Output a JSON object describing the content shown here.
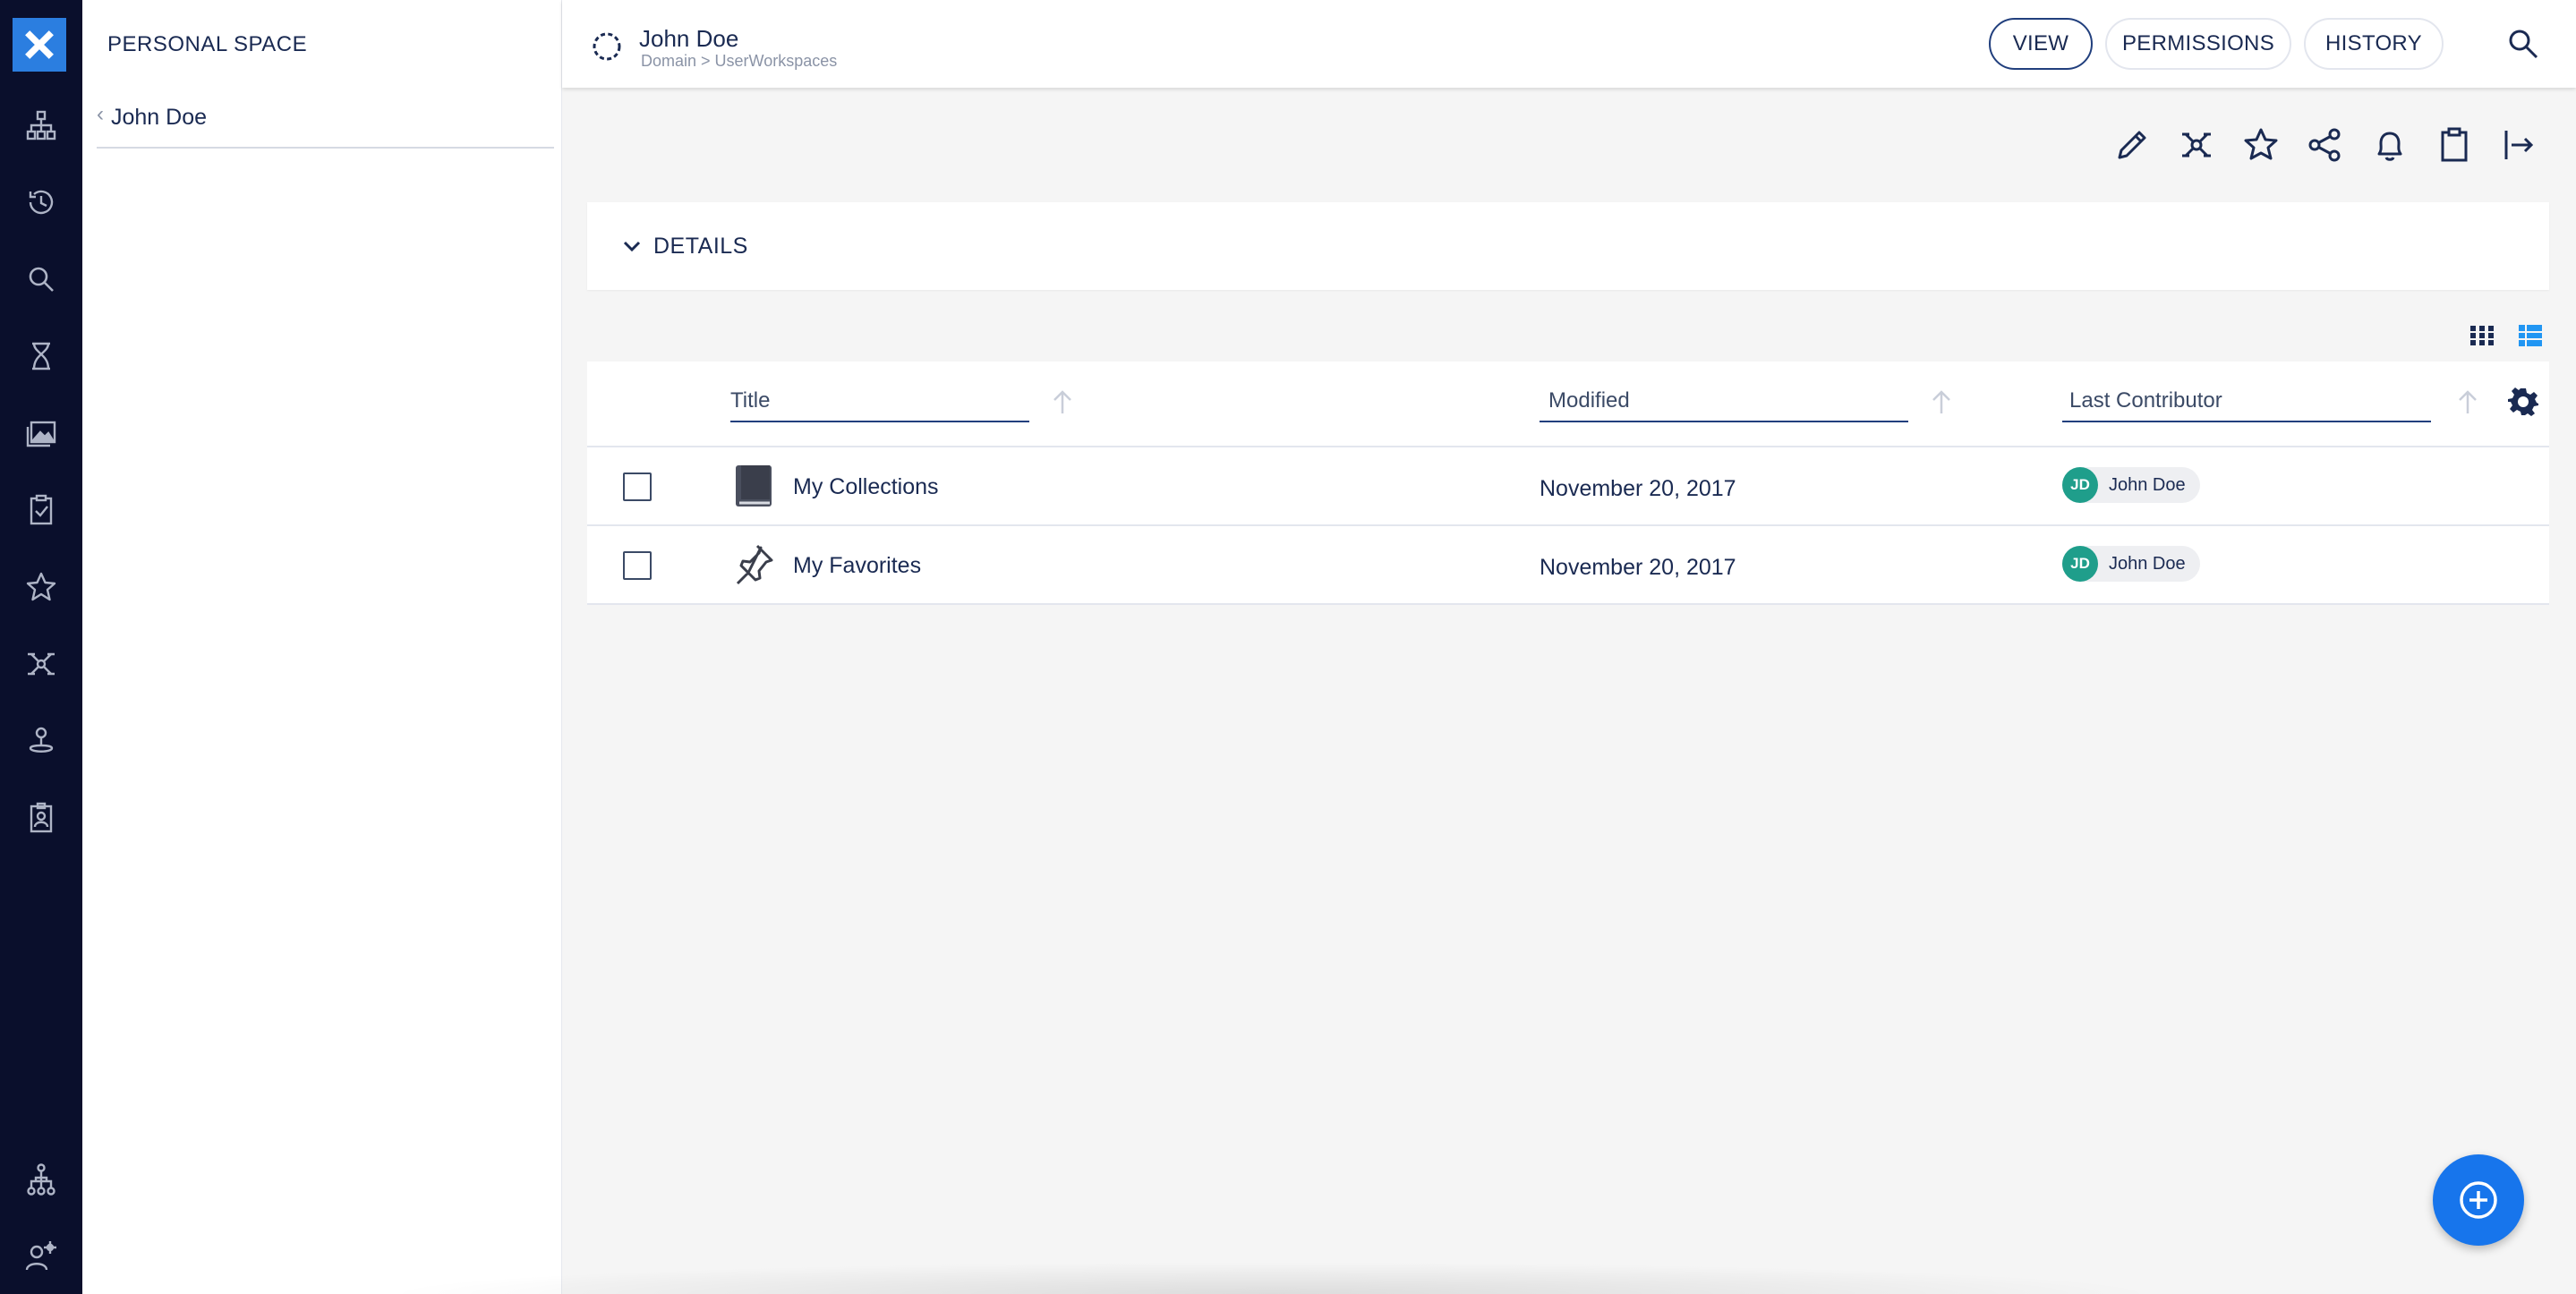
{
  "drawer": {
    "heading": "PERSONAL SPACE",
    "breadcrumb": "John Doe"
  },
  "header": {
    "title": "John Doe",
    "path": "Domain > UserWorkspaces",
    "tabs": [
      {
        "label": "VIEW",
        "active": true
      },
      {
        "label": "PERMISSIONS",
        "active": false
      },
      {
        "label": "HISTORY",
        "active": false
      }
    ]
  },
  "details": {
    "label": "DETAILS"
  },
  "table": {
    "columns": {
      "title": "Title",
      "modified": "Modified",
      "contributor": "Last Contributor"
    },
    "rows": [
      {
        "title": "My Collections",
        "icon": "book-icon",
        "modified": "November 20, 2017",
        "initials": "JD",
        "contributor": "John Doe"
      },
      {
        "title": "My Favorites",
        "icon": "pin-icon",
        "modified": "November 20, 2017",
        "initials": "JD",
        "contributor": "John Doe"
      }
    ]
  },
  "colors": {
    "rail": "#0a0f2c",
    "accent": "#1775ec",
    "avatar": "#1f9e8b",
    "primary_text": "#1a2a52"
  },
  "icons": {
    "rail": [
      "nuxeo-logo-icon",
      "browse-tree-icon",
      "history-icon",
      "search-icon",
      "hourglass-icon",
      "media-icon",
      "tasks-icon",
      "favorites-star-icon",
      "collections-icon",
      "clipboard-user-icon",
      "profile-badge-icon",
      "hierarchy-icon",
      "user-settings-icon"
    ],
    "toolbar": [
      "edit-pencil-icon",
      "add-to-collection-icon",
      "favorite-star-icon",
      "share-icon",
      "notification-bell-icon",
      "clipboard-icon",
      "export-icon"
    ]
  }
}
